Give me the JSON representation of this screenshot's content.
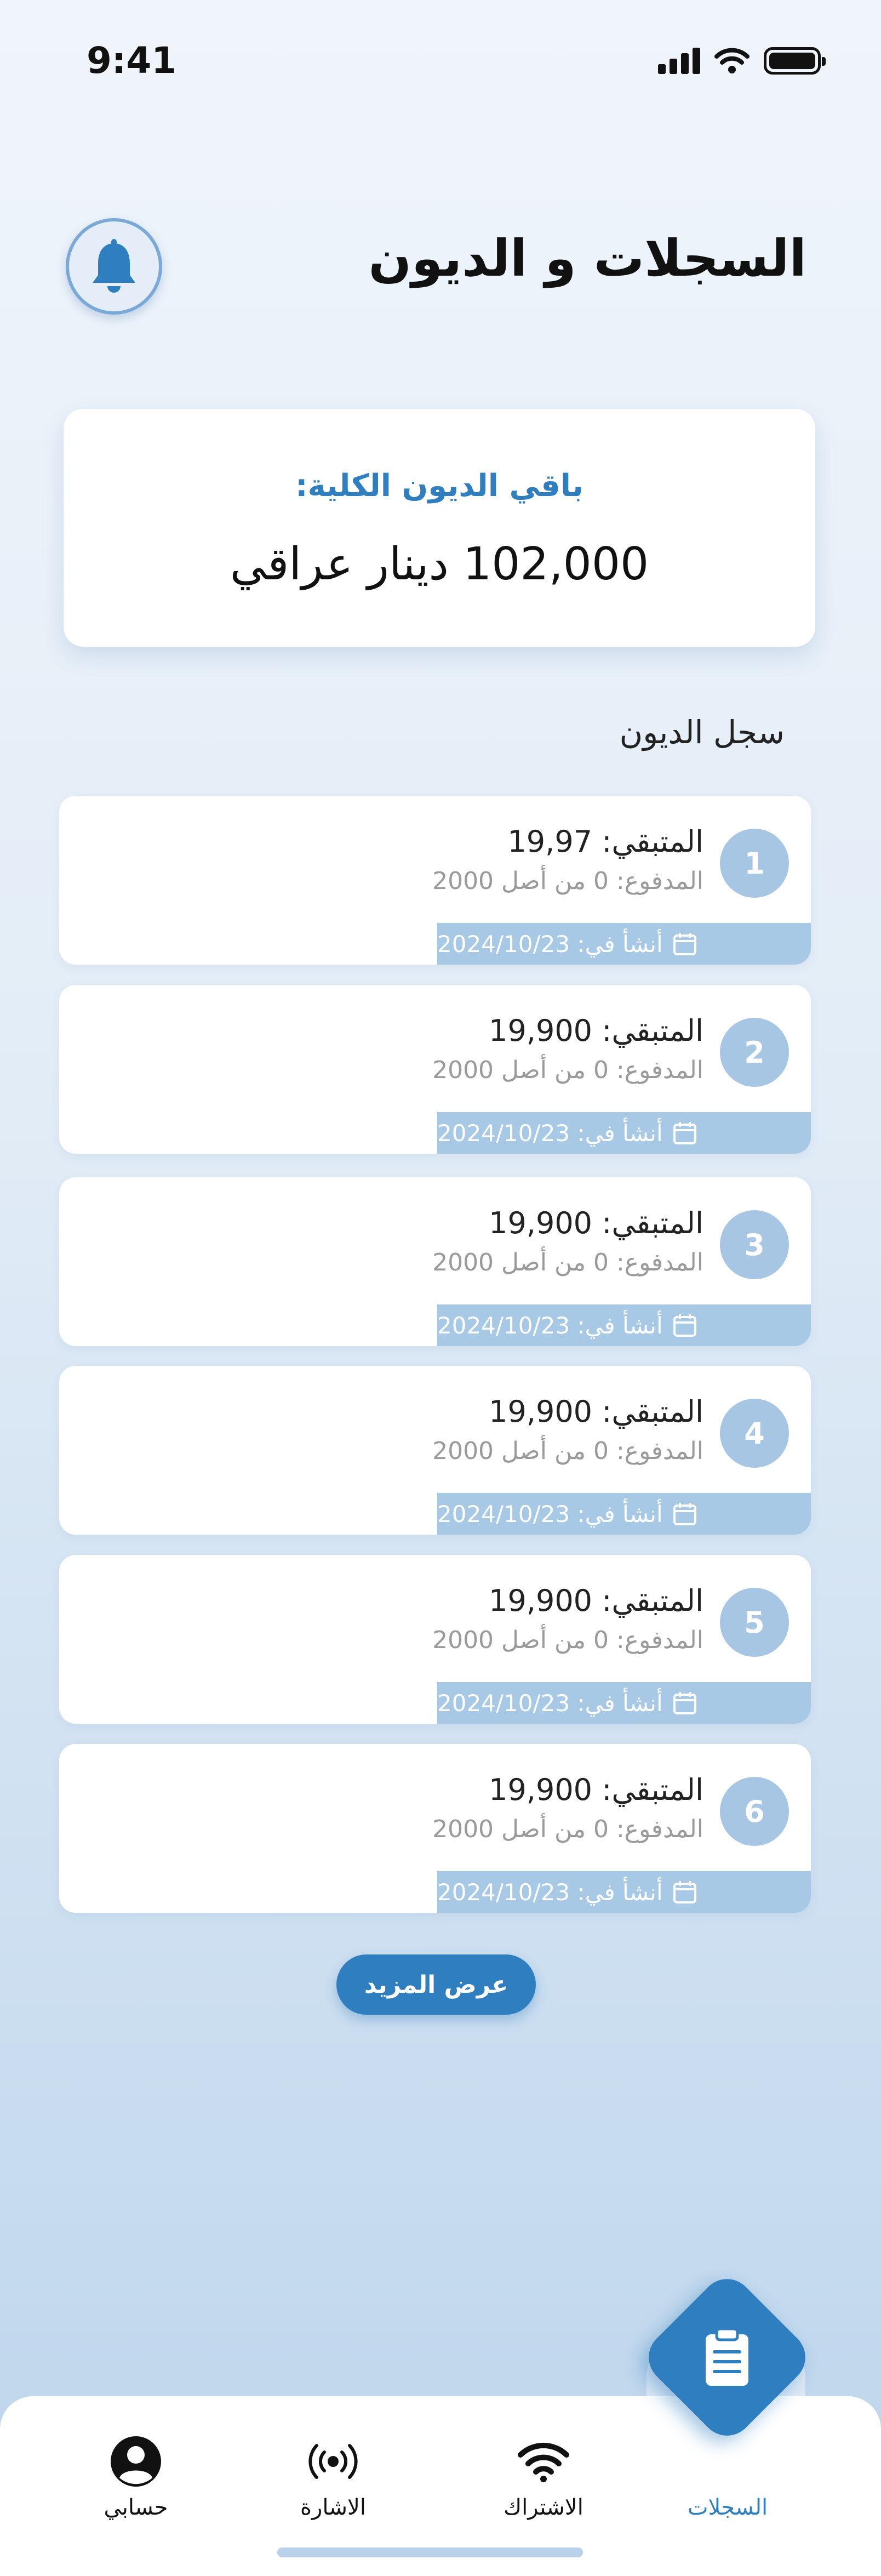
{
  "status_bar": {
    "time": "9:41"
  },
  "header": {
    "title": "السجلات و الديون",
    "bell_icon": "bell-icon"
  },
  "summary": {
    "label": "باقي الديون الكلية:",
    "value": "102,000 دينار عراقي"
  },
  "section_title": "سجل الديون",
  "debts": [
    {
      "number": "1",
      "remaining": "المتبقي: 19,97",
      "paid": "المدفوع: 0 من أصل 2000",
      "date": "أنشأ في: 2024/10/23"
    },
    {
      "number": "2",
      "remaining": "المتبقي: 19,900",
      "paid": "المدفوع: 0 من أصل 2000",
      "date": "أنشأ في: 2024/10/23"
    },
    {
      "number": "3",
      "remaining": "المتبقي: 19,900",
      "paid": "المدفوع: 0 من أصل 2000",
      "date": "أنشأ في: 2024/10/23"
    },
    {
      "number": "4",
      "remaining": "المتبقي: 19,900",
      "paid": "المدفوع: 0 من أصل 2000",
      "date": "أنشأ في: 2024/10/23"
    },
    {
      "number": "5",
      "remaining": "المتبقي: 19,900",
      "paid": "المدفوع: 0 من أصل 2000",
      "date": "أنشأ في: 2024/10/23"
    },
    {
      "number": "6",
      "remaining": "المتبقي: 19,900",
      "paid": "المدفوع: 0 من أصل 2000",
      "date": "أنشأ في: 2024/10/23"
    }
  ],
  "more_button": "عرض المزيد",
  "nav": {
    "account": "حسابي",
    "signal": "الاشارة",
    "subscription": "الاشتراك",
    "records": "السجلات"
  },
  "colors": {
    "accent": "#2f7fc0",
    "badge": "#a7c6e3",
    "date_strip": "#a8c9e6"
  },
  "icons": {
    "calendar": "calendar-icon",
    "clipboard": "clipboard-icon",
    "account": "account-circle-icon",
    "signal": "broadcast-icon",
    "wifi": "wifi-icon"
  }
}
